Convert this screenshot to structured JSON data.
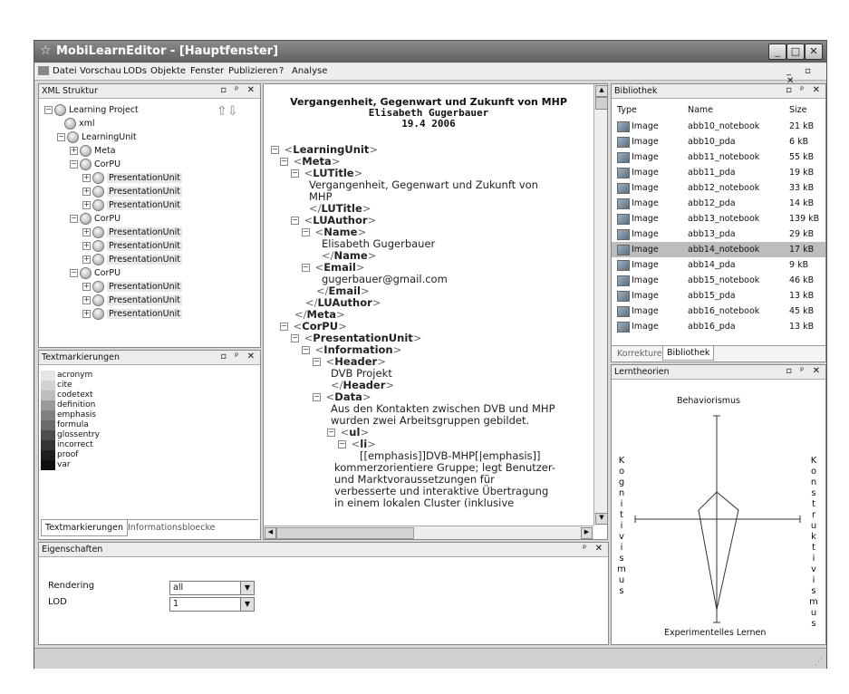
{
  "window": {
    "title": "MobiLearnEditor - [Hauptfenster]"
  },
  "menu": [
    "Datei",
    "Vorschau",
    "LODs",
    "Objekte",
    "Fenster",
    "Publizieren",
    "?",
    "Analyse"
  ],
  "xml_panel": {
    "title": "XML Struktur"
  },
  "tree": {
    "root": "Learning Project",
    "xml": "xml",
    "unit": "LearningUnit",
    "meta": "Meta",
    "corpu": "CorPU",
    "pu": "PresentationUnit"
  },
  "text_panel": {
    "title": "Textmarkierungen",
    "items": [
      "acronym",
      "cite",
      "codetext",
      "definition",
      "emphasis",
      "formula",
      "glossentry",
      "incorrect",
      "proof",
      "var"
    ],
    "swatches": [
      "#e6e6e6",
      "#d2d2d2",
      "#bdbdbd",
      "#9a9a9a",
      "#808080",
      "#6a6a6a",
      "#4c4c4c",
      "#333333",
      "#1e1e1e",
      "#0f0f0f"
    ],
    "tab1": "Textmarkierungen",
    "tab2": "Informationsbloecke"
  },
  "props_panel": {
    "title": "Eigenschaften",
    "rendering_label": "Rendering",
    "rendering_value": "all",
    "lod_label": "LOD",
    "lod_value": "1"
  },
  "editor": {
    "head1": "Vergangenheit, Gegenwart und Zukunft von MHP",
    "head2": "Elisabeth Gugerbauer",
    "head3": "19.4 2006",
    "lines": {
      "lu": "LearningUnit",
      "meta": "Meta",
      "lutitle": "LUTitle",
      "lutitle_text1": "Vergangenheit, Gegenwart und Zukunft von",
      "lutitle_text2": "MHP",
      "luauthor": "LUAuthor",
      "name": "Name",
      "name_text": "Elisabeth Gugerbauer",
      "email": "Email",
      "email_text": "gugerbauer@gmail.com",
      "corpu": "CorPU",
      "pu": "PresentationUnit",
      "information": "Information",
      "header": "Header",
      "header_text": "DVB Projekt",
      "data": "Data",
      "data_text1": "Aus den Kontakten zwischen DVB und MHP",
      "data_text2": "wurden zwei Arbeitsgruppen gebildet.",
      "ul": "ul",
      "li": "li",
      "li_text1": "[[emphasis]]DVB-MHP[|emphasis]]",
      "li_text2": "kommerzorientiere Gruppe; legt Benutzer-",
      "li_text3": "und Marktvoraussetzungen für",
      "li_text4": "verbesserte und interaktive Übertragung",
      "li_text5": "in einem lokalen Cluster (inklusive"
    }
  },
  "library": {
    "title": "Bibliothek",
    "columns": [
      "Type",
      "Name",
      "Size"
    ],
    "rows": [
      {
        "type": "Image",
        "name": "abb10_notebook",
        "size": "21 kB"
      },
      {
        "type": "Image",
        "name": "abb10_pda",
        "size": "6 kB"
      },
      {
        "type": "Image",
        "name": "abb11_notebook",
        "size": "55 kB"
      },
      {
        "type": "Image",
        "name": "abb11_pda",
        "size": "19 kB"
      },
      {
        "type": "Image",
        "name": "abb12_notebook",
        "size": "33 kB"
      },
      {
        "type": "Image",
        "name": "abb12_pda",
        "size": "14 kB"
      },
      {
        "type": "Image",
        "name": "abb13_notebook",
        "size": "139 kB"
      },
      {
        "type": "Image",
        "name": "abb13_pda",
        "size": "29 kB"
      },
      {
        "type": "Image",
        "name": "abb14_notebook",
        "size": "17 kB"
      },
      {
        "type": "Image",
        "name": "abb14_pda",
        "size": "9 kB"
      },
      {
        "type": "Image",
        "name": "abb15_notebook",
        "size": "46 kB"
      },
      {
        "type": "Image",
        "name": "abb15_pda",
        "size": "13 kB"
      },
      {
        "type": "Image",
        "name": "abb16_notebook",
        "size": "45 kB"
      },
      {
        "type": "Image",
        "name": "abb16_pda",
        "size": "13 kB"
      }
    ],
    "selected_row": 8,
    "tab1": "Korrekturen",
    "tab2": "Bibliothek"
  },
  "lern": {
    "title": "Lerntheorien",
    "top": "Behaviorismus",
    "bottom": "Experimentelles Lernen",
    "left": "Kognitivismus",
    "right": "Konstruktivismus"
  }
}
